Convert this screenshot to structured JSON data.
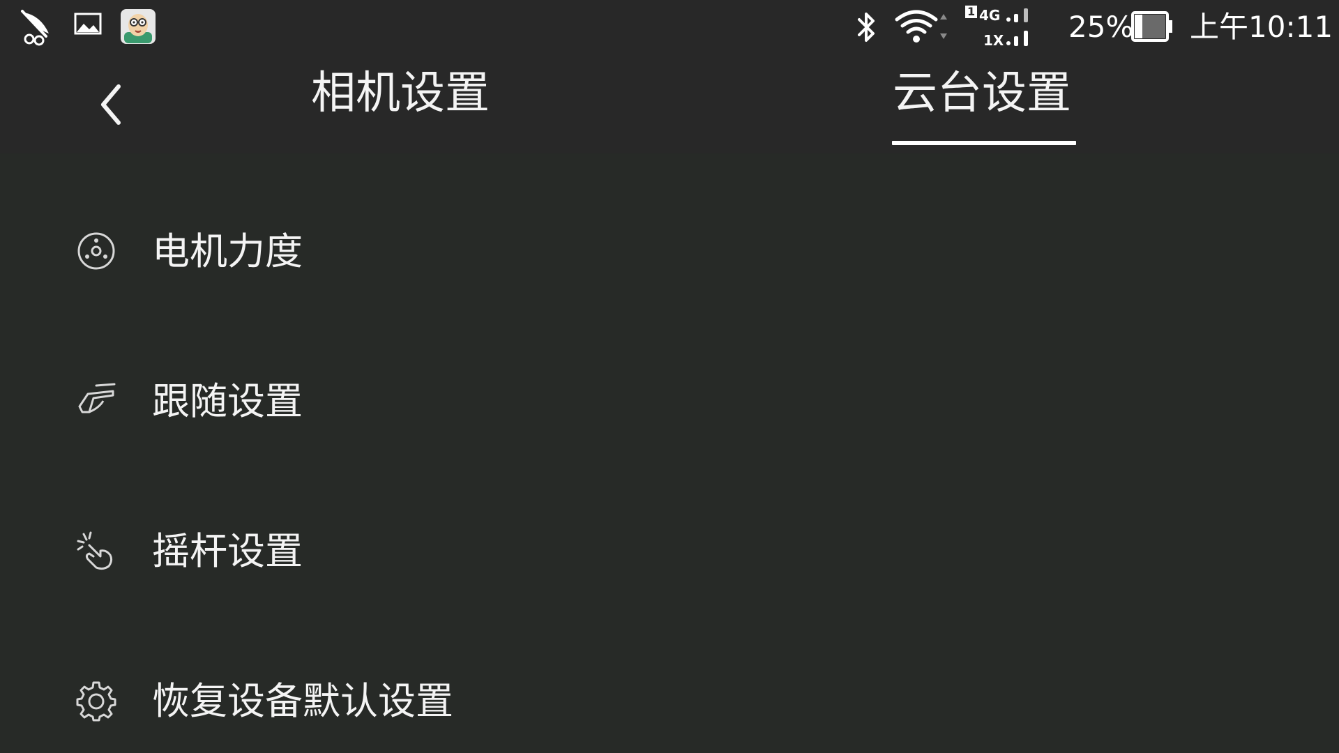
{
  "status_bar": {
    "left_icons": [
      "app-feather-icon",
      "gallery-icon",
      "avatar-app-icon"
    ],
    "sim_slot": "1",
    "network_top": "4G",
    "network_bottom": "1X",
    "battery_percent": "25%",
    "battery_level": 0.25,
    "time": "上午10:11"
  },
  "header": {
    "tabs": [
      {
        "label": "相机设置",
        "active": false
      },
      {
        "label": "云台设置",
        "active": true
      }
    ]
  },
  "menu": {
    "items": [
      {
        "label": "电机力度",
        "icon": "motor-icon"
      },
      {
        "label": "跟随设置",
        "icon": "follow-icon"
      },
      {
        "label": "摇杆设置",
        "icon": "joystick-icon"
      },
      {
        "label": "恢复设备默认设置",
        "icon": "gear-icon"
      }
    ]
  },
  "colors": {
    "background": "#272a27",
    "bar": "#282828",
    "text": "#f4f4f4",
    "accent": "#ffffff"
  }
}
